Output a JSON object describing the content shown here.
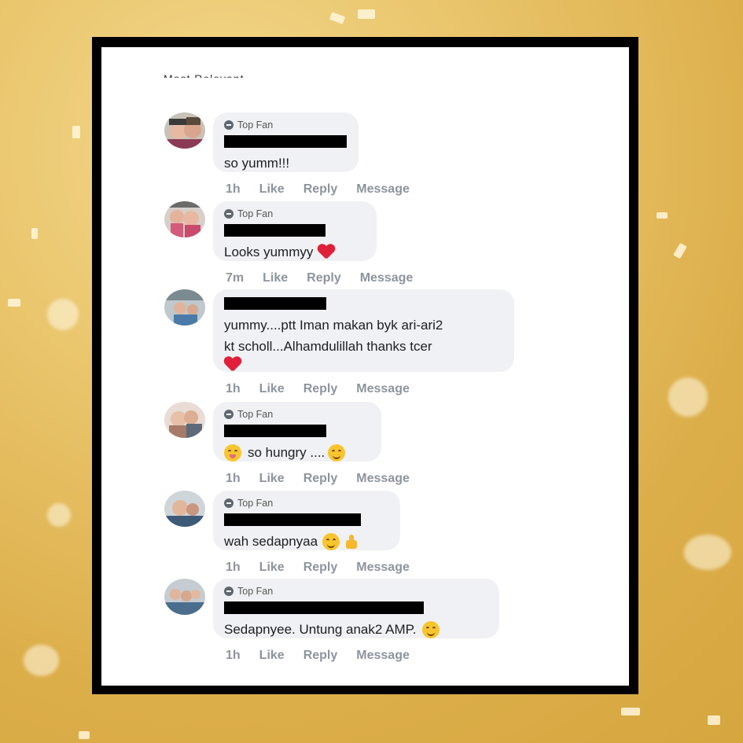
{
  "header_partial": "Most Relevant",
  "badge_label": "Top Fan",
  "comments": [
    {
      "time": "1h",
      "like": "Like",
      "reply": "Reply",
      "message": "Message",
      "text": "so yumm!!!",
      "top_fan": true,
      "emoji": []
    },
    {
      "time": "7m",
      "like": "Like",
      "reply": "Reply",
      "message": "Message",
      "text": "Looks yummyy",
      "top_fan": true,
      "emoji": [
        "red-heart"
      ]
    },
    {
      "time": "1h",
      "like": "Like",
      "reply": "Reply",
      "message": "Message",
      "text_line1": "yummy....ptt Iman makan byk ari-ari2",
      "text_line2": "kt scholl...Alhamdulillah thanks tcer",
      "top_fan": false,
      "emoji": [
        "red-heart"
      ]
    },
    {
      "time": "1h",
      "like": "Like",
      "reply": "Reply",
      "message": "Message",
      "text": "so hungry ....",
      "top_fan": true,
      "emoji": [
        "tongue-face",
        "smiling-face"
      ]
    },
    {
      "time": "1h",
      "like": "Like",
      "reply": "Reply",
      "message": "Message",
      "text": "wah sedapnyaa",
      "top_fan": true,
      "emoji": [
        "smiling-face",
        "thumbs-up"
      ]
    },
    {
      "time": "1h",
      "like": "Like",
      "reply": "Reply",
      "message": "Message",
      "text": "Sedapnyee. Untung anak2 AMP.",
      "top_fan": true,
      "emoji": [
        "smiling-face"
      ]
    }
  ],
  "colors": {
    "background": "#e9c46a",
    "frame": "#000000",
    "bubble": "#f0f1f4",
    "action_text": "#8d949e",
    "heart": "#e0203a"
  }
}
